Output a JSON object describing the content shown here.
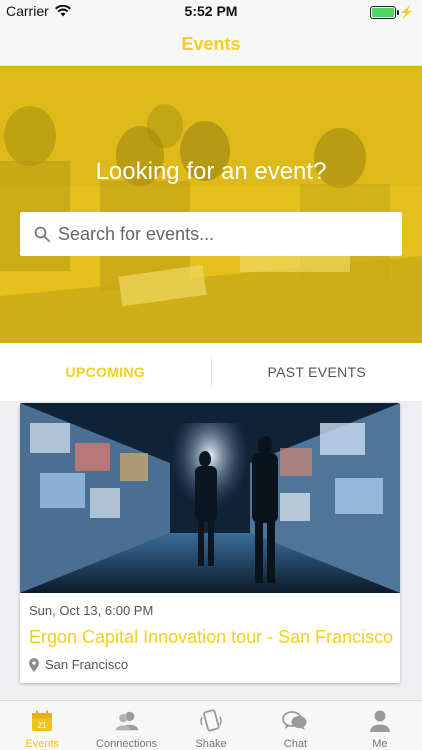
{
  "status_bar": {
    "carrier": "Carrier",
    "time": "5:52 PM"
  },
  "nav": {
    "title": "Events"
  },
  "hero": {
    "title": "Looking for an event?",
    "search_placeholder": "Search for events..."
  },
  "tabs": [
    {
      "label": "UPCOMING",
      "active": true
    },
    {
      "label": "PAST EVENTS",
      "active": false
    }
  ],
  "event_card": {
    "date": "Sun, Oct 13, 6:00 PM",
    "title": "Ergon Capital Innovation tour - San Francisco",
    "location": "San Francisco"
  },
  "tab_bar": [
    {
      "label": "Events",
      "icon": "calendar-icon",
      "active": true
    },
    {
      "label": "Connections",
      "icon": "people-icon",
      "active": false
    },
    {
      "label": "Shake",
      "icon": "shake-phone-icon",
      "active": false
    },
    {
      "label": "Chat",
      "icon": "chat-bubbles-icon",
      "active": false
    },
    {
      "label": "Me",
      "icon": "person-icon",
      "active": false
    }
  ],
  "colors": {
    "accent": "#f4cf1d",
    "hero_tint": "#e6c31b",
    "battery": "#4cd964"
  }
}
